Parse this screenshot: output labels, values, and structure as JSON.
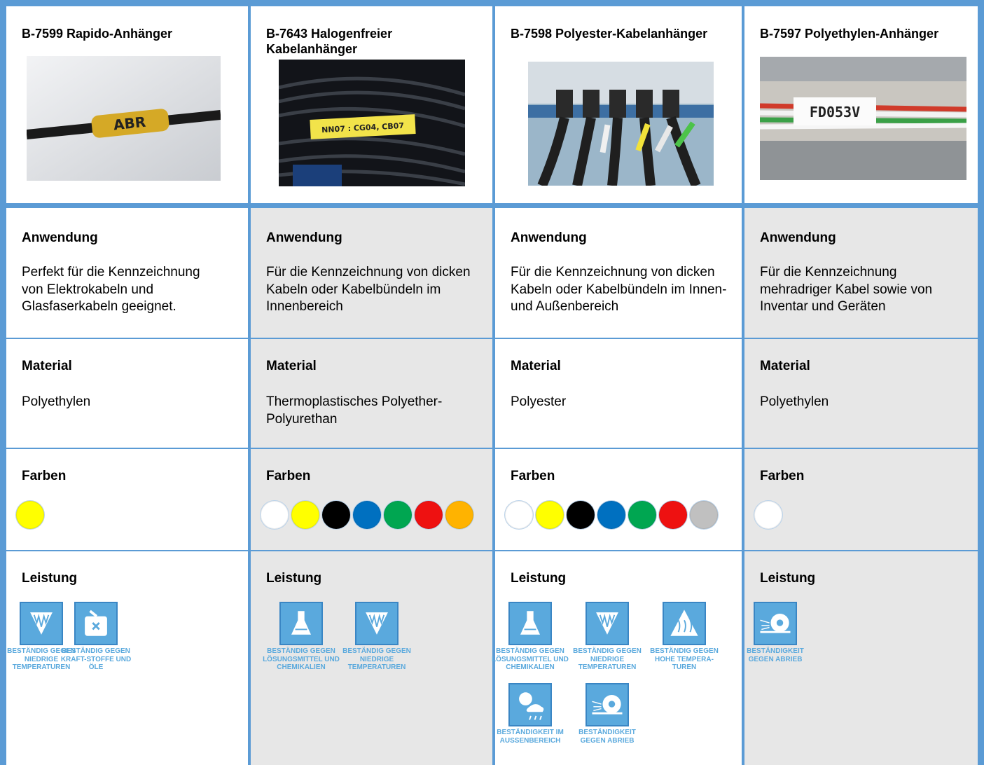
{
  "products": [
    {
      "title": "B-7599 Rapido-Anhänger",
      "photo_label": "ABR",
      "application": "Perfekt für die Kennzeichnung von Elektrokabeln und Glasfaserkabeln geeignet.",
      "material": "Polyethylen",
      "colors": [
        "#ffff00"
      ],
      "performance": [
        {
          "icon": "low-temperature-icon",
          "label": "BESTÄNDIG GEGEN NIEDRIGE TEMPERATUREN"
        },
        {
          "icon": "fuel-oil-icon",
          "label": "BESTÄNDIG GEGEN KRAFT-STOFFE UND ÖLE"
        }
      ]
    },
    {
      "title": "B-7643 Halogenfreier Kabelanhänger",
      "photo_label": "NN07 : CG04, CB07",
      "application": "Für die Kennzeichnung von dicken Kabeln oder Kabelbündeln im Innenbereich",
      "material": "Thermoplastisches Polyether-Polyurethan",
      "colors": [
        "#ffffff",
        "#ffff00",
        "#000000",
        "#0070c0",
        "#00a651",
        "#ee1111",
        "#ffb300"
      ],
      "performance": [
        {
          "icon": "solvent-flask-icon",
          "label": "BESTÄNDIG GEGEN LÖSUNGSMITTEL UND CHEMIKALIEN"
        },
        {
          "icon": "low-temperature-icon",
          "label": "BESTÄNDIG GEGEN NIEDRIGE TEMPERATUREN"
        }
      ]
    },
    {
      "title": "B-7598 Polyester-Kabelanhänger",
      "photo_label": "",
      "application": "Für die Kennzeichnung von dicken Kabeln oder Kabelbündeln im Innen- und Außenbereich",
      "material": "Polyester",
      "colors": [
        "#ffffff",
        "#ffff00",
        "#000000",
        "#0070c0",
        "#00a651",
        "#ee1111",
        "#c0c0c0"
      ],
      "performance": [
        {
          "icon": "solvent-flask-icon",
          "label": "BESTÄNDIG GEGEN LÖSUNGSMITTEL UND CHEMIKALIEN"
        },
        {
          "icon": "low-temperature-icon",
          "label": "BESTÄNDIG GEGEN NIEDRIGE TEMPERATUREN"
        },
        {
          "icon": "high-temperature-icon",
          "label": "BESTÄNDIG GEGEN HOHE TEMPERA-TUREN"
        },
        {
          "icon": "outdoor-weather-icon",
          "label": "BESTÄNDIGKEIT IM AUSSENBEREICH"
        },
        {
          "icon": "abrasion-icon",
          "label": "BESTÄNDIGKEIT GEGEN ABRIEB"
        }
      ]
    },
    {
      "title": "B-7597 Polyethylen-Anhänger",
      "photo_label": "FD053V",
      "application": "Für die Kennzeichnung mehradriger Kabel sowie von Inventar und Geräten",
      "material": "Polyethylen",
      "colors": [
        "#ffffff"
      ],
      "performance": [
        {
          "icon": "abrasion-icon",
          "label": "BESTÄNDIGKEIT GEGEN ABRIEB"
        }
      ]
    }
  ],
  "headings": {
    "application": "Anwendung",
    "material": "Material",
    "colors": "Farben",
    "performance": "Leistung"
  }
}
